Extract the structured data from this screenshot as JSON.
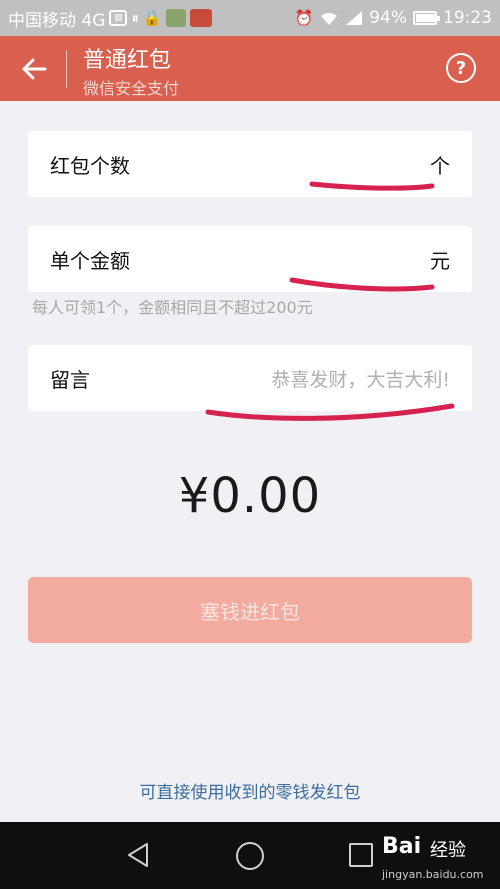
{
  "status_bar": {
    "carrier": "中国移动 4G",
    "battery": "94%",
    "battery_level": 0.94,
    "time": "19:23",
    "icons": [
      "image-icon",
      "pause-icon",
      "lock-icon",
      "app-icon",
      "app-icon",
      "alarm-icon",
      "wifi-icon",
      "signal-icon",
      "battery-icon"
    ]
  },
  "header": {
    "title": "普通红包",
    "subtitle": "微信安全支付",
    "back_icon": "back-arrow-icon",
    "help_label": "?"
  },
  "form": {
    "count": {
      "label": "红包个数",
      "unit": "个"
    },
    "amount": {
      "label": "单个金额",
      "unit": "元"
    },
    "hint": "每人可领1个，金额相同且不超过200元",
    "message": {
      "label": "留言",
      "placeholder": "恭喜发财，大吉大利!"
    }
  },
  "total": "¥0.00",
  "submit_label": "塞钱进红包",
  "change_link": "可直接使用收到的零钱发红包",
  "nav_bar": {
    "watermark": "Bai",
    "watermark_sub": "经验",
    "watermark_url": "jingyan.baidu.com"
  },
  "colors": {
    "header": "#d9604f",
    "button": "#f2ab9e",
    "annotation": "#d6224e",
    "link": "#3b6e9c"
  }
}
